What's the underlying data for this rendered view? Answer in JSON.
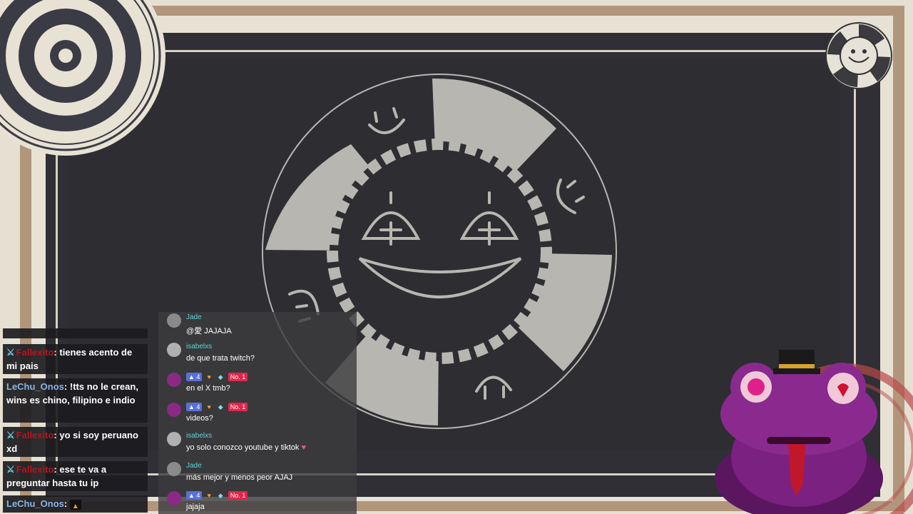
{
  "colors": {
    "accent_red": "#b5151e",
    "chat_name_teal": "#5fd2d8",
    "frame_tan": "#b1967c",
    "stage_bg": "#2d2d32"
  },
  "overlay": {
    "center_logo_icon": "poker-chip-smiley-icon",
    "corner_badge_icon": "poker-chip-small-icon",
    "rings_icon": "concentric-rings-icon",
    "mascot_icon": "purple-frog-mascot-icon"
  },
  "chat_left": {
    "messages": [
      {
        "user": "Fallexito",
        "user_color": "red",
        "text": "tienes acento de mi pais"
      },
      {
        "user": "LeChu_Onos",
        "user_color": "blue",
        "text": "!tts no le crean, wins es chino, filipino e indio"
      },
      {
        "user": "Fallexito",
        "user_color": "red",
        "text": "yo si soy peruano xd"
      },
      {
        "user": "Fallexito",
        "user_color": "red",
        "text": "ese te va a preguntar hasta tu ip"
      },
      {
        "user": "LeChu_Onos",
        "user_color": "blue",
        "text": ""
      }
    ]
  },
  "chat_right": {
    "messages": [
      {
        "name": "Jade",
        "text": "@愛 JAJAJA",
        "badges": false
      },
      {
        "name": "isabelxs",
        "text": "de que trata twitch?",
        "badges": false
      },
      {
        "name": "",
        "text": "en el X tmb?",
        "badges": true,
        "badge_count": "4",
        "badge_rank": "No. 1"
      },
      {
        "name": "",
        "text": "videos?",
        "badges": true,
        "badge_count": "4",
        "badge_rank": "No. 1"
      },
      {
        "name": "isabelxs",
        "text": "yo solo conozco youtube y tiktok",
        "badges": false
      },
      {
        "name": "Jade",
        "text": "más mejor y menos peor AJAJ",
        "badges": false
      },
      {
        "name": "",
        "text": "jajaja",
        "badges": true,
        "badge_count": "4",
        "badge_rank": "No. 1"
      }
    ]
  }
}
